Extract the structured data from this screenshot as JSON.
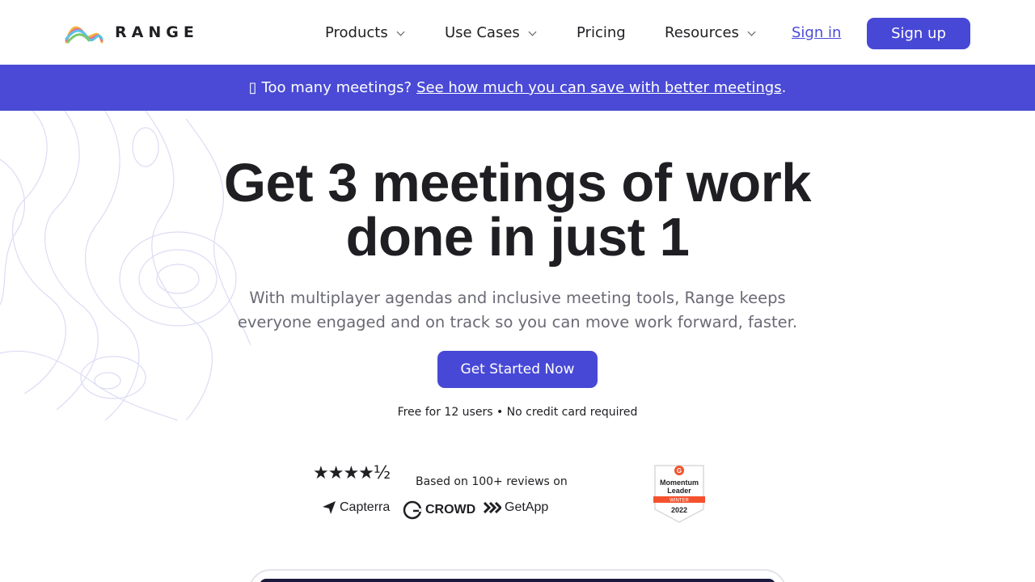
{
  "brand": {
    "name": "RANGE"
  },
  "nav": {
    "items": [
      {
        "label": "Products",
        "has_dropdown": true
      },
      {
        "label": "Use Cases",
        "has_dropdown": true
      },
      {
        "label": "Pricing",
        "has_dropdown": false
      },
      {
        "label": "Resources",
        "has_dropdown": true
      }
    ],
    "signin": "Sign in",
    "signup": "Sign up"
  },
  "banner": {
    "text": "Too many meetings?",
    "link": "See how much you can save with better meetings",
    "suffix": "."
  },
  "hero": {
    "title_line1": "Get 3 meetings of work",
    "title_line2": "done in just 1",
    "subtitle": "With multiplayer agendas and inclusive meeting tools, Range keeps everyone engaged and on track so you can move work forward, faster.",
    "cta": "Get Started Now",
    "fine_print": "Free for 12 users • No credit card required"
  },
  "reviews": {
    "stars": "★★★★½",
    "rating": 4.5,
    "based_on": "Based on 100+ reviews on",
    "sources": [
      "Capterra",
      "CROWD",
      "GetApp"
    ],
    "badge": {
      "title1": "Momentum",
      "title2": "Leader",
      "ribbon": "WINTER",
      "year": "2022"
    }
  },
  "colors": {
    "accent": "#4848d6",
    "banner": "#4a4ad6",
    "text": "#1f1f23",
    "muted": "#6a6a75",
    "badge_red": "#f4522d"
  }
}
